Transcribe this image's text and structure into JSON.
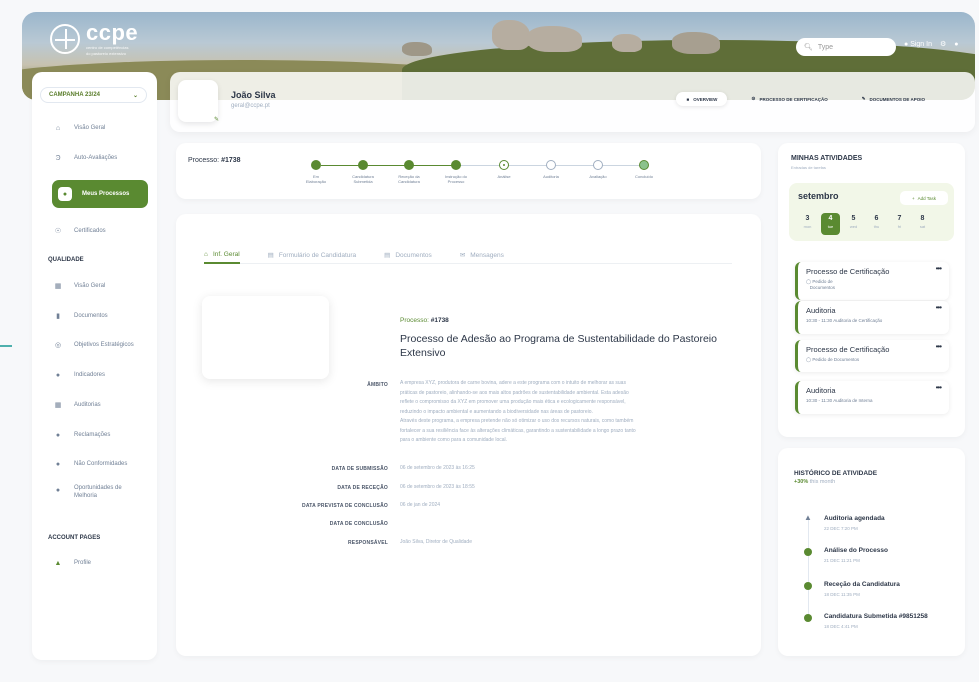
{
  "brand": {
    "logo_text": "ccpe",
    "logo_sub_1": "centro de competências",
    "logo_sub_2": "do pastoreio extensivo"
  },
  "header": {
    "search_placeholder": "Type",
    "signin_label": "Sign In"
  },
  "sidebar": {
    "campaign": "CAMPANHA 23/24",
    "items_top": [
      {
        "label": "Visão Geral",
        "icon": "home-icon"
      },
      {
        "label": "Auto-Avaliações",
        "icon": "sheep-icon"
      },
      {
        "label": "Meus Processos",
        "icon": "sheep-face-icon"
      },
      {
        "label": "Certificados",
        "icon": "badge-icon"
      }
    ],
    "section_quality": "QUALIDADE",
    "items_quality": [
      {
        "label": "Visão Geral"
      },
      {
        "label": "Documentos"
      },
      {
        "label": "Objetivos Estratégicos"
      },
      {
        "label": "Indicadores"
      },
      {
        "label": "Auditorias"
      },
      {
        "label": "Reclamações"
      },
      {
        "label": "Não Conformidades"
      },
      {
        "label": "Oportunidades de",
        "label2": "Melhoria"
      }
    ],
    "section_account": "ACCOUNT PAGES",
    "profile": "Profile"
  },
  "profile": {
    "name": "João Silva",
    "email": "geral@ccpe.pt",
    "tabs": [
      "OVERVIEW",
      "PROCESSO DE CERTIFICAÇÃO",
      "DOCUMENTOS DE APOIO"
    ]
  },
  "process": {
    "label": "Processo:",
    "id": "#1738",
    "steps": [
      {
        "l1": "Em",
        "l2": "Elaboração",
        "state": "done"
      },
      {
        "l1": "Candidatura",
        "l2": "Submetida",
        "state": "done"
      },
      {
        "l1": "Receção da",
        "l2": "Candidatura",
        "state": "done"
      },
      {
        "l1": "Instrução do",
        "l2": "Processo",
        "state": "done"
      },
      {
        "l1": "Análise",
        "l2": "",
        "state": "current"
      },
      {
        "l1": "Auditoria",
        "l2": "",
        "state": "todo"
      },
      {
        "l1": "Avaliação",
        "l2": "",
        "state": "todo"
      },
      {
        "l1": "Concluído",
        "l2": "",
        "state": "last"
      }
    ]
  },
  "main": {
    "tabs": [
      "Inf. Geral",
      "Formulário de Candidatura",
      "Documentos",
      "Mensagens"
    ],
    "process_label": "Processo:",
    "process_id": "#1738",
    "title": "Processo de Adesão ao Programa de Sustentabilidade do Pastoreio Extensivo",
    "fields": {
      "ambito_label": "ÂMBITO",
      "ambito_lines": [
        "A empresa XYZ, produtora de carne bovina, adere a este programa com o intuito de melhorar as suas",
        "práticas de pastoreio, alinhando-se aos mais altos padrões de sustentabilidade ambiental. Esta adesão",
        "reflete o compromisso da XYZ em promover uma produção mais ética e ecologicamente responsável,",
        "reduzindo o impacto ambiental e aumentando a biodiversidade nas áreas de pastoreio.",
        "Através deste programa, a empresa pretende não só otimizar o uso dos recursos naturais, como também",
        "fortalecer a sua resiliência face às alterações climáticas, garantindo a sustentabilidade a longo prazo tanto",
        "para o ambiente como para a comunidade local."
      ],
      "submissao_label": "DATA DE SUBMISSÃO",
      "submissao": "06 de setembro de 2023 às 16:25",
      "rececao_label": "DATA DE RECEÇÃO",
      "rececao": "06 de setembro de 2023 às 18:55",
      "prevista_label": "DATA PREVISTA DE CONCLUSÃO",
      "prevista": "06 de jan de 2024",
      "conclusao_label": "DATA DE CONCLUSÃO",
      "conclusao": "",
      "responsavel_label": "RESPONSÁVEL",
      "responsavel": "João Silva, Diretor de Qualidade"
    }
  },
  "activities": {
    "title": "MINHAS ATIVIDADES",
    "subtitle": "Entradas de tarefas",
    "month": "setembro",
    "add_task": "Add Task",
    "days": [
      {
        "n": "3",
        "w": "mon"
      },
      {
        "n": "4",
        "w": "tue"
      },
      {
        "n": "5",
        "w": "wed"
      },
      {
        "n": "6",
        "w": "thu"
      },
      {
        "n": "7",
        "w": "fri"
      },
      {
        "n": "8",
        "w": "sat"
      }
    ],
    "items": [
      {
        "title": "Processo de Certificação",
        "d1": "Pedido de",
        "d2": "Documentos"
      },
      {
        "title": "Auditoria",
        "d1": "10:30 - 11:30 Auditoria de Certificação",
        "d2": ""
      },
      {
        "title": "Processo de Certificação",
        "d1": "Pedido de Documentos",
        "d2": ""
      },
      {
        "title": "Auditoria",
        "d1": "10:30 - 11:30 Auditoria de Interna",
        "d2": ""
      }
    ],
    "more": "•••"
  },
  "history": {
    "title": "HISTÓRICO DE ATIVIDADE",
    "pct": "+30%",
    "pct_label": "this month",
    "items": [
      {
        "title": "Auditoria agendada",
        "date": "22 DEC 7:20 PM"
      },
      {
        "title": "Análise do Processo",
        "date": "21 DEC 11:21 PM"
      },
      {
        "title": "Receção da Candidatura",
        "date": "18 DEC 11:35 PM"
      },
      {
        "title": "Candidatura Submetida #9851258",
        "date": "18 DEC 4:41 PM"
      }
    ]
  }
}
